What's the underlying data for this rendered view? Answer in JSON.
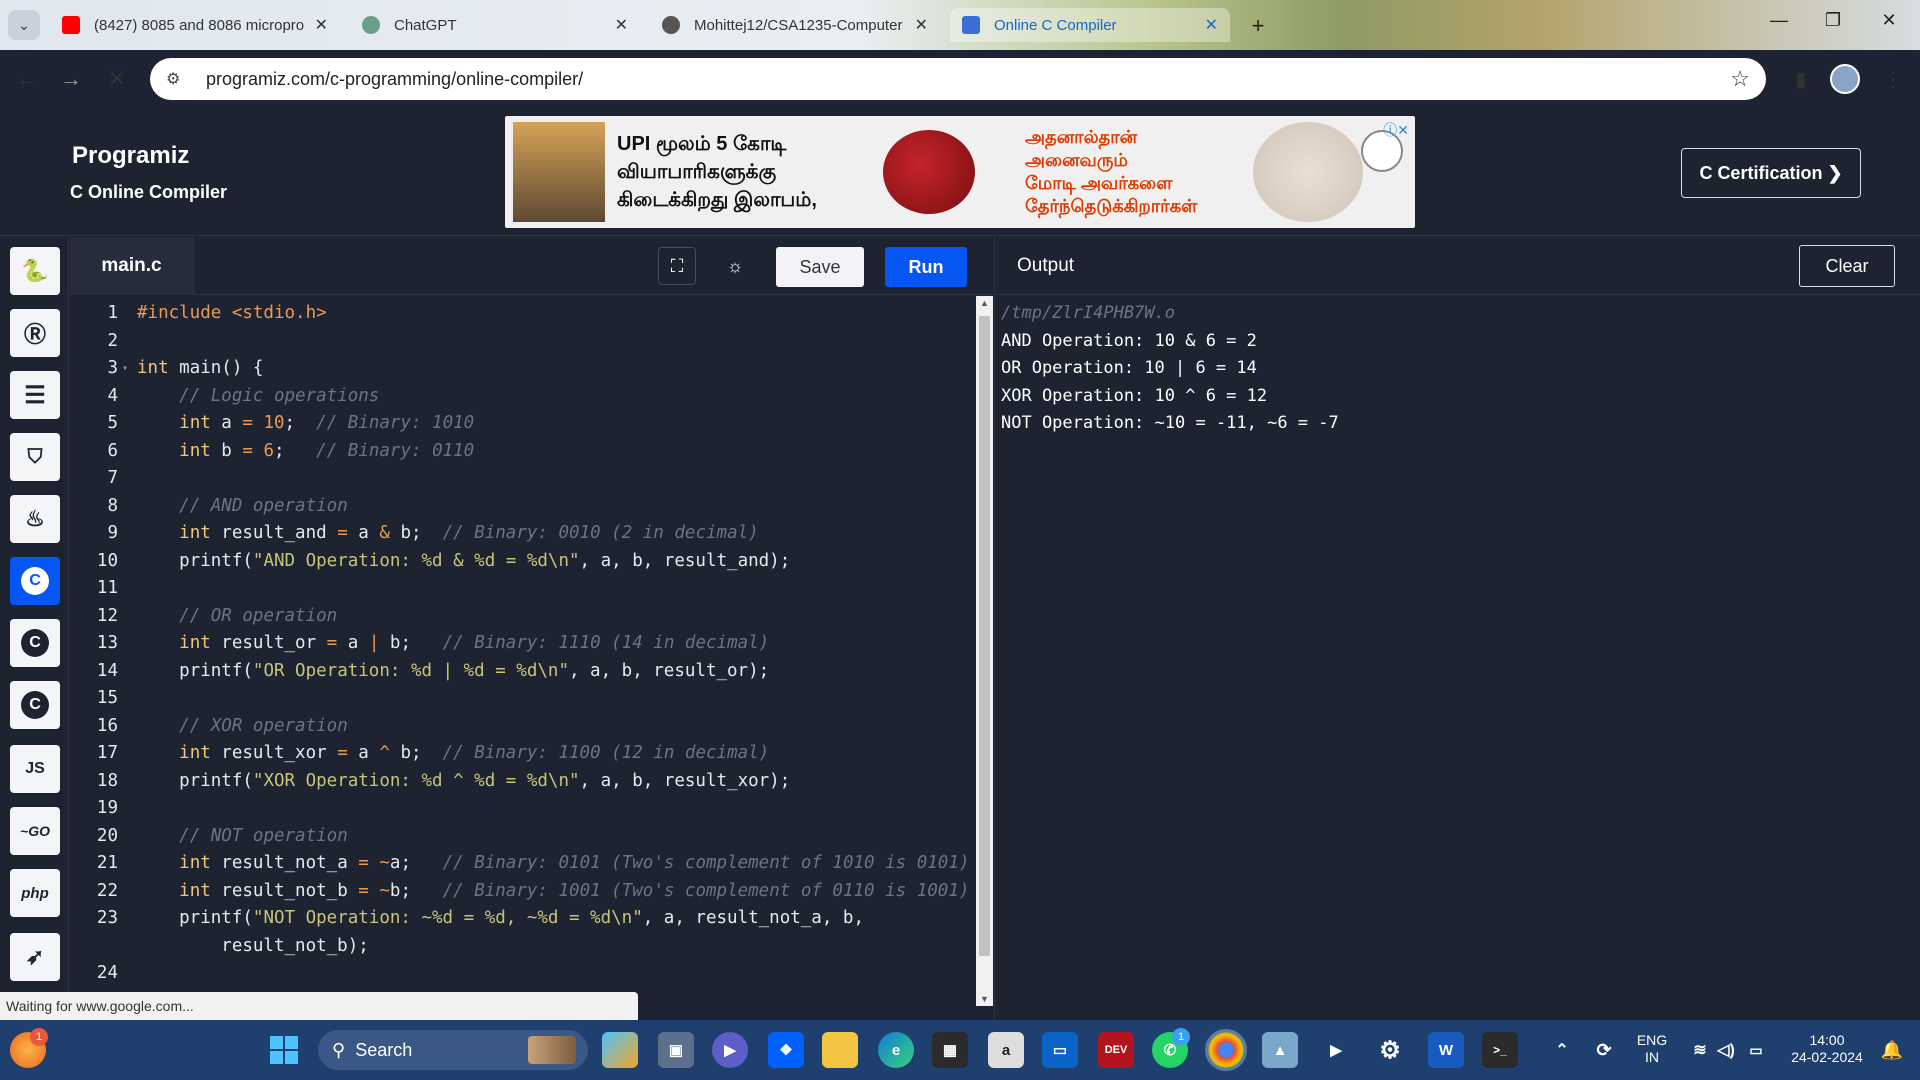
{
  "browser": {
    "tabs": [
      {
        "title": "(8427) 8085 and 8086 micropro",
        "favicon": "youtube-icon",
        "color": "#ff0000",
        "active": false
      },
      {
        "title": "ChatGPT",
        "favicon": "chatgpt-icon",
        "color": "#6b9e8a",
        "active": false
      },
      {
        "title": "Mohittej12/CSA1235-Computer",
        "favicon": "github-icon",
        "color": "#555555",
        "active": false
      },
      {
        "title": "Online C Compiler",
        "favicon": "programiz-icon",
        "color": "#3b6fd8",
        "active": true
      }
    ],
    "url": "programiz.com/c-programming/online-compiler/",
    "status": "Waiting for www.google.com..."
  },
  "header": {
    "logo": "Programiz",
    "subtitle": "C Online Compiler",
    "certification_label": "C Certification ❯",
    "ad": {
      "line1": "UPI மூலம் 5 கோடி",
      "line2": "வியாபாரிகளுக்கு",
      "line3": "கிடைக்கிறது இலாபம்,",
      "line4": "அதனால்தான்",
      "line5": "அனைவரும்",
      "line6": "மோடி அவர்களை",
      "line7": "தேர்ந்தெடுக்கிறார்கள்"
    }
  },
  "sidebar": {
    "languages": [
      {
        "name": "python",
        "glyph": "🐍",
        "active": false
      },
      {
        "name": "r",
        "glyph": "R",
        "active": false
      },
      {
        "name": "sql",
        "glyph": "≡",
        "active": false
      },
      {
        "name": "html",
        "glyph": "5",
        "active": false
      },
      {
        "name": "java",
        "glyph": "☕",
        "active": false
      },
      {
        "name": "c",
        "glyph": "C",
        "active": true
      },
      {
        "name": "cpp",
        "glyph": "C",
        "active": false
      },
      {
        "name": "csharp",
        "glyph": "C",
        "active": false
      },
      {
        "name": "javascript",
        "glyph": "JS",
        "active": false
      },
      {
        "name": "go",
        "glyph": "~GO",
        "active": false
      },
      {
        "name": "php",
        "glyph": "php",
        "active": false
      },
      {
        "name": "swift",
        "glyph": "➶",
        "active": false
      }
    ]
  },
  "editor": {
    "filename": "main.c",
    "save_label": "Save",
    "run_label": "Run",
    "lines": [
      {
        "n": "1",
        "html": "<span class=\"pre\">#include &lt;stdio.h&gt;</span>"
      },
      {
        "n": "2",
        "html": ""
      },
      {
        "n": "3",
        "html": "<span class=\"kw\">int</span> main() {",
        "fold": true
      },
      {
        "n": "4",
        "html": "    <span class=\"cmt\">// Logic operations</span>"
      },
      {
        "n": "5",
        "html": "    <span class=\"kw\">int</span> a <span class=\"op\">=</span> <span class=\"num\">10</span>;  <span class=\"cmt\">// Binary: 1010</span>"
      },
      {
        "n": "6",
        "html": "    <span class=\"kw\">int</span> b <span class=\"op\">=</span> <span class=\"num\">6</span>;   <span class=\"cmt\">// Binary: 0110</span>"
      },
      {
        "n": "7",
        "html": ""
      },
      {
        "n": "8",
        "html": "    <span class=\"cmt\">// AND operation</span>"
      },
      {
        "n": "9",
        "html": "    <span class=\"kw\">int</span> result_and <span class=\"op\">=</span> a <span class=\"op\">&amp;</span> b;  <span class=\"cmt\">// Binary: 0010 (2 in decimal)</span>"
      },
      {
        "n": "10",
        "html": "    printf(<span class=\"str\">\"AND Operation: %d &amp; %d = %d\\n\"</span>, a, b, result_and);"
      },
      {
        "n": "11",
        "html": ""
      },
      {
        "n": "12",
        "html": "    <span class=\"cmt\">// OR operation</span>"
      },
      {
        "n": "13",
        "html": "    <span class=\"kw\">int</span> result_or <span class=\"op\">=</span> a <span class=\"op\">|</span> b;   <span class=\"cmt\">// Binary: 1110 (14 in decimal)</span>"
      },
      {
        "n": "14",
        "html": "    printf(<span class=\"str\">\"OR Operation: %d | %d = %d\\n\"</span>, a, b, result_or);"
      },
      {
        "n": "15",
        "html": ""
      },
      {
        "n": "16",
        "html": "    <span class=\"cmt\">// XOR operation</span>"
      },
      {
        "n": "17",
        "html": "    <span class=\"kw\">int</span> result_xor <span class=\"op\">=</span> a <span class=\"op\">^</span> b;  <span class=\"cmt\">// Binary: 1100 (12 in decimal)</span>"
      },
      {
        "n": "18",
        "html": "    printf(<span class=\"str\">\"XOR Operation: %d ^ %d = %d\\n\"</span>, a, b, result_xor);"
      },
      {
        "n": "19",
        "html": ""
      },
      {
        "n": "20",
        "html": "    <span class=\"cmt\">// NOT operation</span>"
      },
      {
        "n": "21",
        "html": "    <span class=\"kw\">int</span> result_not_a <span class=\"op\">=</span> <span class=\"op\">~</span>a;   <span class=\"cmt\">// Binary: 0101 (Two's complement of 1010 is 0101)</span>"
      },
      {
        "n": "22",
        "html": "    <span class=\"kw\">int</span> result_not_b <span class=\"op\">=</span> <span class=\"op\">~</span>b;   <span class=\"cmt\">// Binary: 1001 (Two's complement of 0110 is 1001)</span>"
      },
      {
        "n": "23",
        "html": "    printf(<span class=\"str\">\"NOT Operation: ~%d = %d, ~%d = %d\\n\"</span>, a, result_not_a, b,"
      },
      {
        "n": "",
        "html": "        result_not_b);"
      },
      {
        "n": "24",
        "html": ""
      }
    ]
  },
  "output": {
    "title": "Output",
    "clear_label": "Clear",
    "lines": [
      {
        "text": "/tmp/ZlrI4PHB7W.o",
        "path": true
      },
      {
        "text": "AND Operation: 10 & 6 = 2",
        "path": false
      },
      {
        "text": "OR Operation: 10 | 6 = 14",
        "path": false
      },
      {
        "text": "XOR Operation: 10 ^ 6 = 12",
        "path": false
      },
      {
        "text": "NOT Operation: ~10 = -11, ~6 = -7",
        "path": false
      }
    ]
  },
  "taskbar": {
    "search_label": "Search",
    "language": "ENG",
    "region": "IN",
    "time": "14:00",
    "date": "24-02-2024",
    "whatsapp_badge": "1",
    "notify_badge": "1"
  }
}
